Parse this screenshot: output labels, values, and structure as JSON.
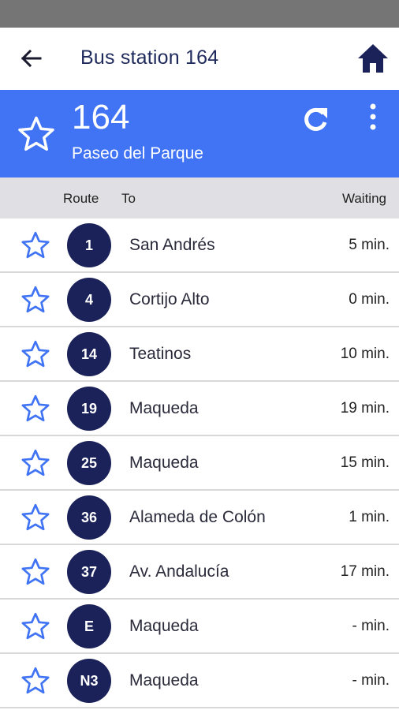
{
  "app_bar": {
    "title": "Bus station 164",
    "back_icon": "arrow-left-icon",
    "home_icon": "home-icon"
  },
  "station": {
    "number": "164",
    "name": "Paseo del Parque"
  },
  "columns": {
    "route": "Route",
    "to": "To",
    "waiting": "Waiting"
  },
  "rows": [
    {
      "route": "1",
      "destination": "San Andrés",
      "waiting": "5 min."
    },
    {
      "route": "4",
      "destination": "Cortijo Alto",
      "waiting": "0 min."
    },
    {
      "route": "14",
      "destination": "Teatinos",
      "waiting": "10 min."
    },
    {
      "route": "19",
      "destination": "Maqueda",
      "waiting": "19 min."
    },
    {
      "route": "25",
      "destination": "Maqueda",
      "waiting": "15 min."
    },
    {
      "route": "36",
      "destination": "Alameda de Colón",
      "waiting": "1 min."
    },
    {
      "route": "37",
      "destination": "Av. Andalucía",
      "waiting": "17 min."
    },
    {
      "route": "E",
      "destination": "Maqueda",
      "waiting": "- min."
    },
    {
      "route": "N3",
      "destination": "Maqueda",
      "waiting": "- min."
    }
  ],
  "colors": {
    "primary_dark": "#1b2259",
    "accent_blue": "#4074f4",
    "header_gray": "#e0e0e4"
  }
}
